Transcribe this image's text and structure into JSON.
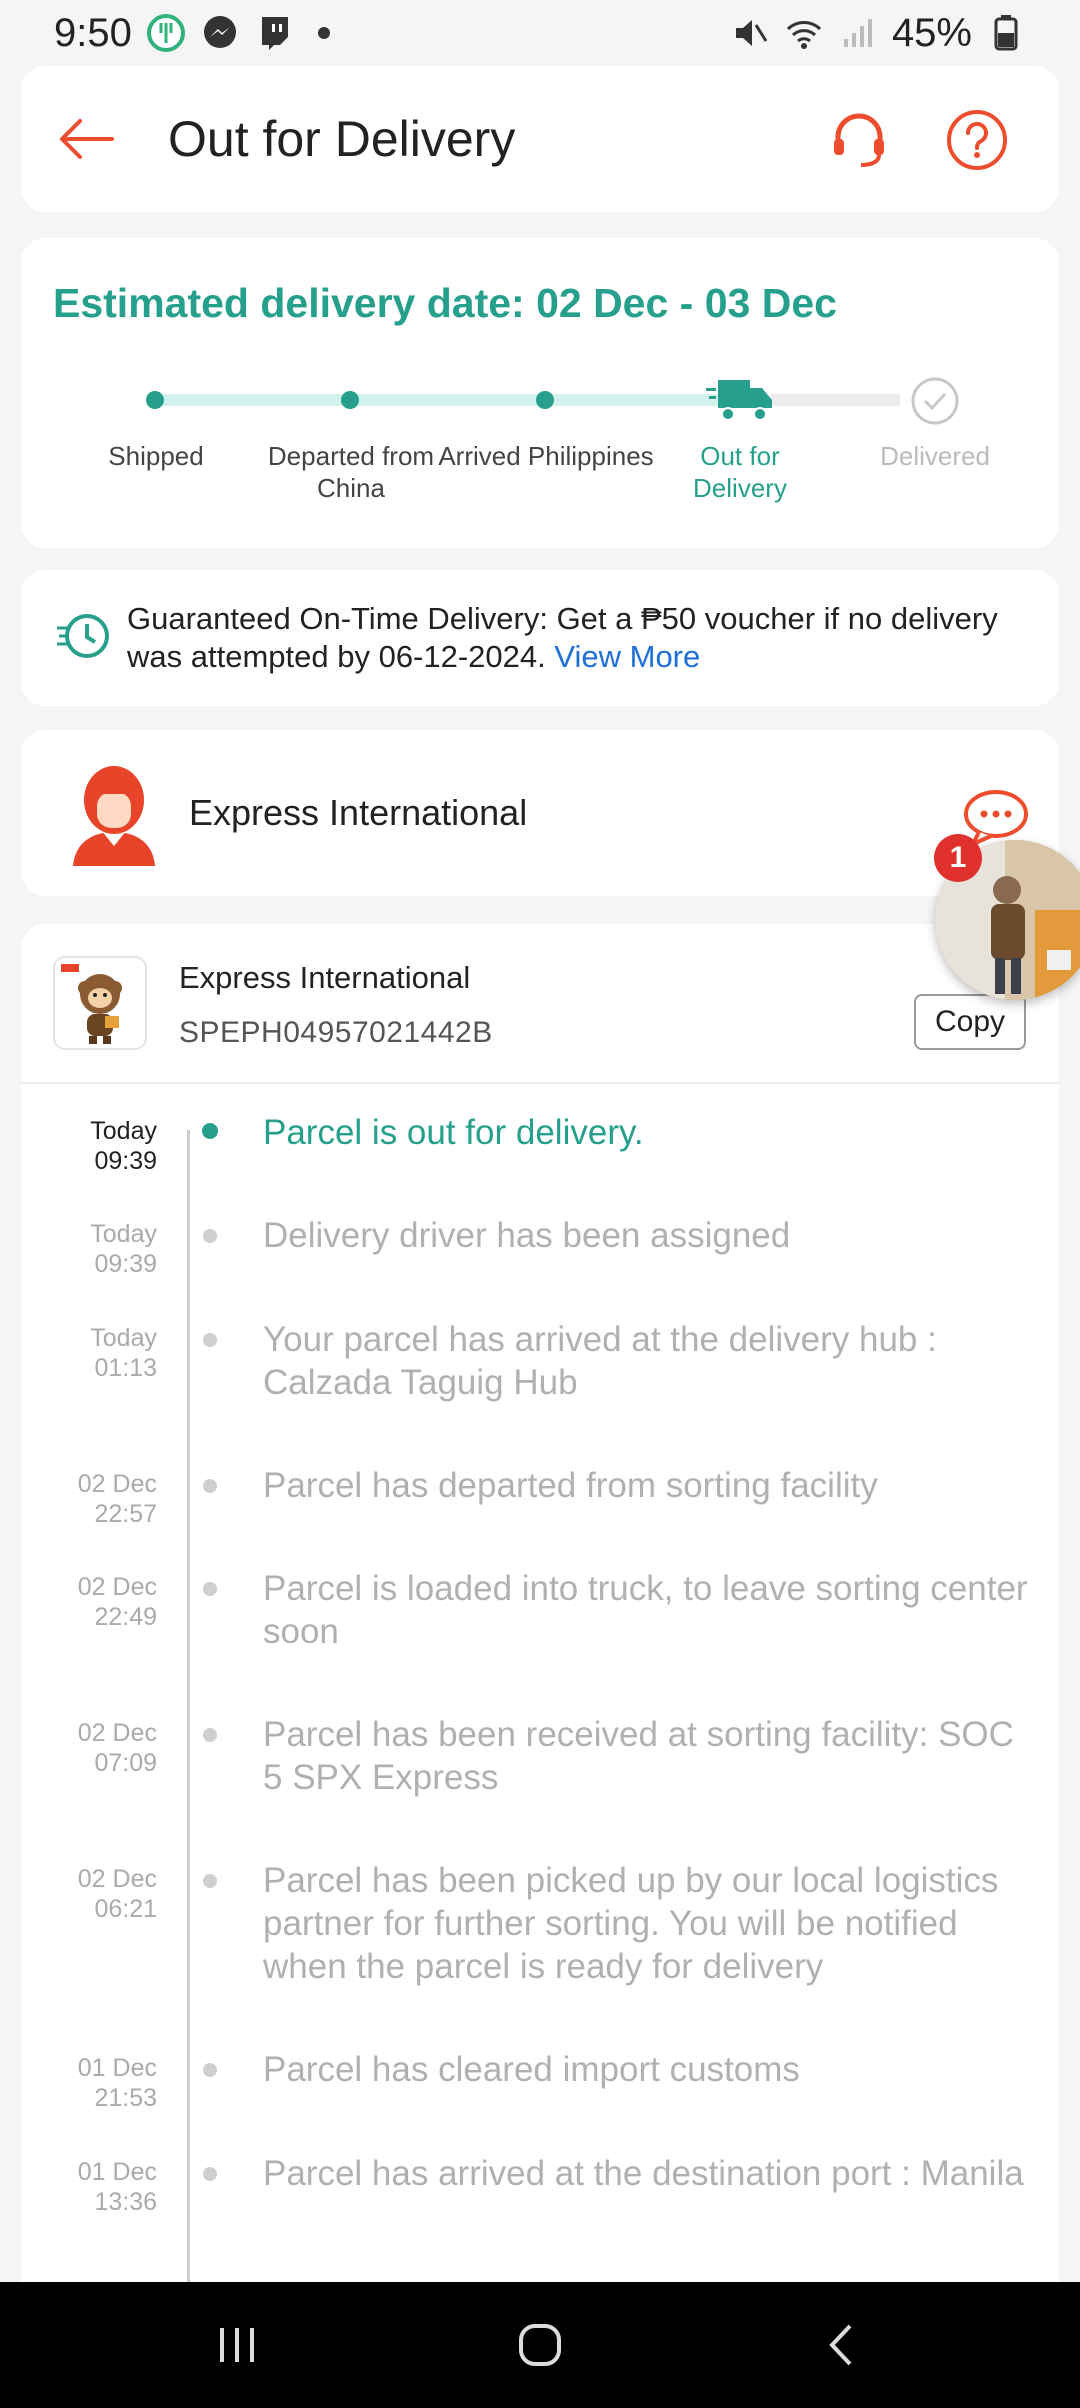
{
  "status_bar": {
    "time": "9:50",
    "battery": "45%",
    "left_icons": [
      "food-app-icon",
      "messenger-icon",
      "twitch-icon",
      "dot"
    ],
    "right_icons": [
      "mute-icon",
      "wifi-icon",
      "signal-icon",
      "battery-icon"
    ]
  },
  "header": {
    "title": "Out for Delivery",
    "icons": [
      "back-arrow-icon",
      "customer-support-icon",
      "help-icon"
    ]
  },
  "progress": {
    "estimated": "Estimated delivery date: 02 Dec  - 03 Dec",
    "stages": [
      {
        "label": "Shipped",
        "state": "done"
      },
      {
        "label": "Departed from China",
        "state": "done"
      },
      {
        "label": "Arrived Philippines",
        "state": "done"
      },
      {
        "label": "Out for Delivery",
        "state": "current"
      },
      {
        "label": "Delivered",
        "state": "pending"
      }
    ]
  },
  "guarantee": {
    "text": "Guaranteed On-Time Delivery: Get a ₱50 voucher if no delivery was attempted by 06-12-2024. ",
    "link": "View More"
  },
  "courier": {
    "name": "Express International"
  },
  "shipment": {
    "carrier": "Express International",
    "tracking_number": "SPEPH04957021442B",
    "copy_label": "Copy"
  },
  "floating": {
    "badge_count": "1"
  },
  "events": [
    {
      "day": "Today",
      "time": "09:39",
      "text": "Parcel is out for delivery.",
      "active": true
    },
    {
      "day": "Today",
      "time": "09:39",
      "text": "Delivery driver has been assigned",
      "active": false
    },
    {
      "day": "Today",
      "time": "01:13",
      "text": "Your parcel has arrived at the delivery hub : Calzada Taguig Hub",
      "active": false
    },
    {
      "day": "02 Dec",
      "time": "22:57",
      "text": "Parcel has departed from sorting facility",
      "active": false
    },
    {
      "day": "02 Dec",
      "time": "22:49",
      "text": "Parcel is loaded into truck, to leave sorting center soon",
      "active": false
    },
    {
      "day": "02 Dec",
      "time": "07:09",
      "text": "Parcel has been received at sorting facility: SOC 5 SPX Express",
      "active": false
    },
    {
      "day": "02 Dec",
      "time": "06:21",
      "text": "Parcel has been picked up by our local logistics partner for further sorting. You will be notified when the parcel is ready for delivery",
      "active": false
    },
    {
      "day": "01 Dec",
      "time": "21:53",
      "text": "Parcel has cleared import customs",
      "active": false
    },
    {
      "day": "01 Dec",
      "time": "13:36",
      "text": "Parcel has arrived at the destination port : Manila",
      "active": false
    }
  ],
  "colors": {
    "accent": "#26a08c",
    "brand": "#ee4d2d",
    "link": "#1e6fd6"
  }
}
